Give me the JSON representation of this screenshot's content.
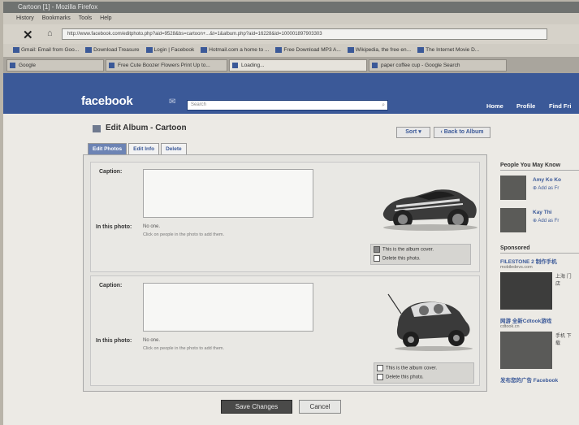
{
  "window": {
    "title": "Cartoon [1] - Mozilla Firefox"
  },
  "menu": [
    "History",
    "Bookmarks",
    "Tools",
    "Help"
  ],
  "address": {
    "url": "http://www.facebook.com/editphoto.php?aid=9528&bs=cartoon+...&t=1&album.php?aid=16228&id=100001897903303"
  },
  "bookmarks": [
    "Gmail: Email from Goo...",
    "Download Treasure",
    "Login | Facebook",
    "Hotmail.com a home to ...",
    "Free Download MP3 A...",
    "Wikipedia, the free en...",
    "The Internet Movie D..."
  ],
  "tabs": [
    "Google",
    "Free Cute Boozer Flowers Print Up to...",
    "Loading...",
    "paper coffee cup - Google Search"
  ],
  "facebook": {
    "logo": "facebook",
    "search_placeholder": "Search",
    "nav": [
      "Home",
      "Profile",
      "Find Fri"
    ]
  },
  "page": {
    "title": "Edit Album - Cartoon",
    "sort_label": "Sort",
    "back_label": "Back to Album",
    "tabs": [
      "Edit Photos",
      "Edit Info",
      "Delete"
    ]
  },
  "photos": [
    {
      "caption_label": "Caption:",
      "in_photo_label": "In this photo:",
      "in_photo_value": "No one.",
      "in_photo_hint": "Click on people in the photo to add them.",
      "cover_option": "This is the album cover.",
      "delete_option": "Delete this photo."
    },
    {
      "caption_label": "Caption:",
      "in_photo_label": "In this photo:",
      "in_photo_value": "No one.",
      "in_photo_hint": "Click on people in the photo to add them.",
      "cover_option": "This is the album cover.",
      "delete_option": "Delete this photo."
    }
  ],
  "sidebar": {
    "pymk_heading": "People You May Know",
    "people": [
      {
        "name": "Amy Ko Ko",
        "add": "Add as Fr"
      },
      {
        "name": "Kay Thi",
        "add": "Add as Fr"
      }
    ],
    "sponsored_heading": "Sponsored",
    "ads": [
      {
        "title": "FILESTONE 2 制作手机",
        "url": "mobiledevs.com"
      },
      {
        "title": "网游 全新Cdtook游戏",
        "url": "cdtook.cn"
      },
      {
        "title": "发布您的广告 Facebook",
        "url": ""
      }
    ]
  },
  "buttons": {
    "save": "Save Changes",
    "cancel": "Cancel"
  }
}
